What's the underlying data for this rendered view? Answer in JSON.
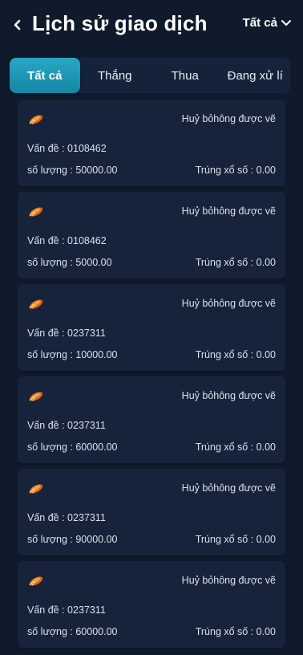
{
  "header": {
    "title": "Lịch sử giao dịch",
    "filter_label": "Tất cả"
  },
  "tabs": [
    {
      "label": "Tất cả",
      "active": true
    },
    {
      "label": "Thắng",
      "active": false
    },
    {
      "label": "Thua",
      "active": false
    },
    {
      "label": "Đang xử lí",
      "active": false
    }
  ],
  "records": [
    {
      "status": "Huỷ bỏhông được vẽ",
      "issue": "Vấn đề : 0108462",
      "quantity": "số lượng : 50000.00",
      "win": "Trúng xổ số : 0.00"
    },
    {
      "status": "Huỷ bỏhông được vẽ",
      "issue": "Vấn đề : 0108462",
      "quantity": "số lượng : 5000.00",
      "win": "Trúng xổ số : 0.00"
    },
    {
      "status": "Huỷ bỏhông được vẽ",
      "issue": "Vấn đề : 0237311",
      "quantity": "số lượng : 10000.00",
      "win": "Trúng xổ số : 0.00"
    },
    {
      "status": "Huỷ bỏhông được vẽ",
      "issue": "Vấn đề : 0237311",
      "quantity": "số lượng : 60000.00",
      "win": "Trúng xổ số : 0.00"
    },
    {
      "status": "Huỷ bỏhông được vẽ",
      "issue": "Vấn đề : 0237311",
      "quantity": "số lượng : 90000.00",
      "win": "Trúng xổ số : 0.00"
    },
    {
      "status": "Huỷ bỏhông được vẽ",
      "issue": "Vấn đề : 0237311",
      "quantity": "số lượng : 60000.00",
      "win": "Trúng xổ số : 0.00"
    }
  ],
  "icons": {
    "back": "chevron-left-icon",
    "filter": "chevron-down-icon",
    "record": "game-token-icon"
  },
  "colors": {
    "background": "#0f1b2d",
    "card": "#16233a",
    "tab_active": "#1e98b8",
    "text": "#e6ecf5"
  }
}
